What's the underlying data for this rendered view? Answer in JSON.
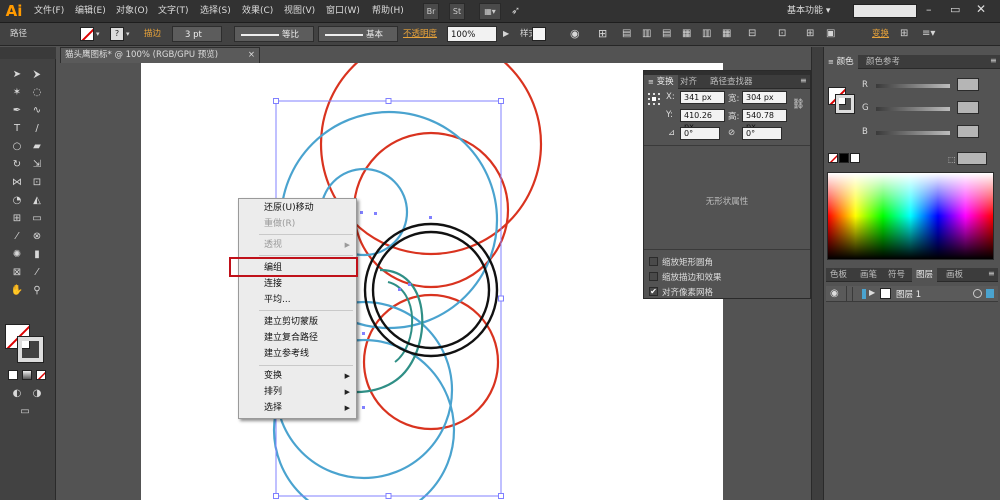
{
  "menubar": {
    "logo": "Ai",
    "items": [
      "文件(F)",
      "编辑(E)",
      "对象(O)",
      "文字(T)",
      "选择(S)",
      "效果(C)",
      "视图(V)",
      "窗口(W)",
      "帮助(H)"
    ],
    "br_label": "Br",
    "st_label": "St",
    "workspace": "基本功能",
    "search_placeholder": ""
  },
  "controlbar": {
    "selection_label": "路径",
    "stroke_label": "描边",
    "stroke_value": "3 pt",
    "profile_label": "等比",
    "brush_label": "基本",
    "opacity_label": "不透明度",
    "opacity_value": "100%",
    "style_label": "样式",
    "transform_label": "变换"
  },
  "document": {
    "tab_title": "猫头鹰图标* @ 100% (RGB/GPU 预览)",
    "close_symbol": "×"
  },
  "context_menu": {
    "items": [
      {
        "label": "还原(U)移动",
        "enabled": true
      },
      {
        "label": "重做(R)",
        "enabled": false
      },
      {
        "label": "透视",
        "enabled": false,
        "submenu": true
      },
      {
        "label": "编组",
        "enabled": true,
        "highlighted": true
      },
      {
        "label": "连接",
        "enabled": true
      },
      {
        "label": "平均...",
        "enabled": true
      },
      {
        "label": "建立剪切蒙版",
        "enabled": true
      },
      {
        "label": "建立复合路径",
        "enabled": true
      },
      {
        "label": "建立参考线",
        "enabled": true
      },
      {
        "label": "变换",
        "enabled": true,
        "submenu": true
      },
      {
        "label": "排列",
        "enabled": true,
        "submenu": true
      },
      {
        "label": "选择",
        "enabled": true,
        "submenu": true
      }
    ],
    "submenu_arrow": "▶"
  },
  "transform_panel": {
    "tabs": [
      "变换",
      "对齐",
      "路径查找器"
    ],
    "x_label": "X:",
    "x_value": "341 px",
    "w_label": "宽:",
    "w_value": "304 px",
    "y_label": "Y:",
    "y_value": "410.26 px",
    "h_label": "高:",
    "h_value": "540.78 px",
    "rotate_value": "0°",
    "shear_value": "0°",
    "no_shape": "无形状属性",
    "options": [
      {
        "label": "缩放矩形圆角",
        "checked": false
      },
      {
        "label": "缩放描边和效果",
        "checked": false
      },
      {
        "label": "对齐像素网格",
        "checked": true
      }
    ]
  },
  "color_panel": {
    "tabs": [
      "颜色",
      "颜色参考"
    ],
    "channels": [
      "R",
      "G",
      "B"
    ]
  },
  "layers_panel": {
    "tabs": [
      "色板",
      "画笔",
      "符号",
      "图层",
      "画板"
    ],
    "layer_name": "图层 1"
  },
  "colors": {
    "blue_circle": "#4aa3cf",
    "red_circle": "#d9331f",
    "black_circle": "#111111",
    "teal_path": "#2f8f86",
    "highlight": "#c0111a",
    "selection": "#8080ff"
  }
}
